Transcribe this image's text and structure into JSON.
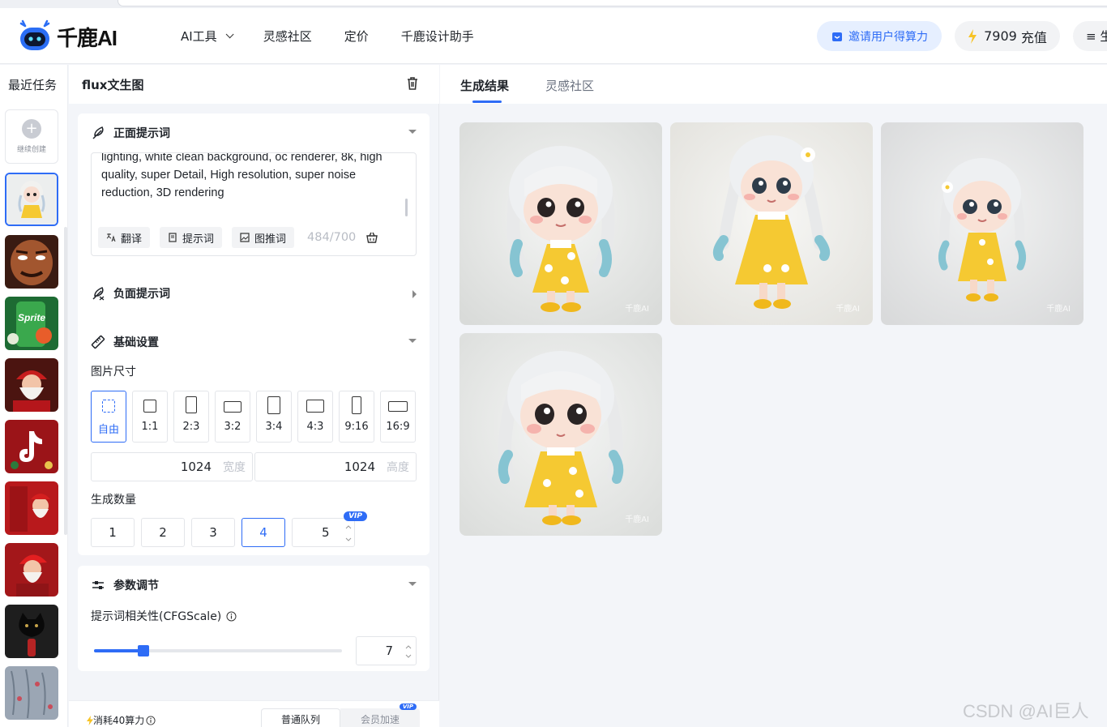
{
  "header": {
    "brand": "千鹿AI",
    "nav": [
      {
        "label": "AI工具",
        "has_dropdown": true
      },
      {
        "label": "灵感社区"
      },
      {
        "label": "定价"
      },
      {
        "label": "千鹿设计助手"
      }
    ],
    "invite_label": "邀请用户得算力",
    "credits": "7909",
    "recharge_label": "充值",
    "menu_label": "≡ 生"
  },
  "recent": {
    "title": "最近任务",
    "new_task_label": "继续创建",
    "thumbnails": [
      "doll-girl",
      "mask-face",
      "sprite-can",
      "santa",
      "tiktok-christmas",
      "santa-door",
      "santa-red",
      "black-cat",
      "floral-pattern"
    ]
  },
  "form": {
    "title": "flux文生图",
    "positive": {
      "title": "正面提示词",
      "text": "lighting, white clean background, oc renderer, 8k, high quality, super Detail, High resolution, super noise reduction, 3D rendering",
      "translate_label": "翻译",
      "prompt_label": "提示词",
      "img2prompt_label": "图推词",
      "counter": "484/700"
    },
    "negative": {
      "title": "负面提示词"
    },
    "basic": {
      "title": "基础设置",
      "size_label": "图片尺寸",
      "ratios": [
        "自由",
        "1:1",
        "2:3",
        "3:2",
        "3:4",
        "4:3",
        "9:16",
        "16:9"
      ],
      "selected_ratio": "自由",
      "width": "1024",
      "width_unit": "宽度",
      "height": "1024",
      "height_unit": "高度",
      "count_label": "生成数量",
      "counts": [
        "1",
        "2",
        "3",
        "4",
        "5"
      ],
      "selected_count": "4",
      "vip_label": "VIP"
    },
    "params": {
      "title": "参数调节",
      "cfg_label": "提示词相关性(CFGScale)",
      "cfg_value": "7",
      "cfg_fraction": 0.2
    },
    "footer": {
      "cost": "消耗40算力",
      "queue_normal": "普通队列",
      "queue_vip": "会员加速",
      "vip_label": "VIP"
    }
  },
  "results": {
    "tabs": [
      "生成结果",
      "灵感社区"
    ],
    "active_tab": "生成结果",
    "images": [
      "doll-result-1",
      "doll-result-2",
      "doll-result-3",
      "doll-result-4"
    ],
    "watermark": "千鹿AI"
  },
  "watermark_text": "CSDN @AI巨人",
  "colors": {
    "accent": "#2e6cf6",
    "doll_dress": "#f5c932",
    "doll_hair": "#eef0f2"
  }
}
